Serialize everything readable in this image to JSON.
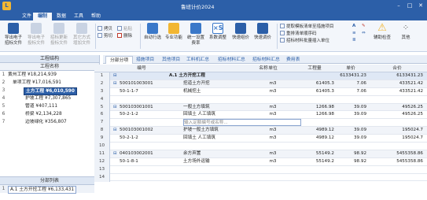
{
  "app": {
    "title": "鲁班计价2024",
    "logo": "L"
  },
  "menu": {
    "tabs": [
      "文件",
      "编制",
      "数据",
      "工具",
      "帮助"
    ],
    "active_index": 1
  },
  "ribbon": {
    "buttons": [
      {
        "label": "导出电子\n招标文件",
        "icon": "export-icon",
        "disabled": false
      },
      {
        "label": "导出电子\n投标文件",
        "icon": "export-bid-icon",
        "disabled": true
      },
      {
        "label": "招标更新\n投标文件",
        "icon": "update-icon",
        "disabled": true
      },
      {
        "label": "其它方式\n增加文件",
        "icon": "add-file-icon",
        "disabled": true
      }
    ],
    "small_group1": [
      "拷贝",
      "剪切",
      "粘贴",
      "删除"
    ],
    "buttons2": [
      {
        "label": "自动行选",
        "icon": "auto-select-icon"
      },
      {
        "label": "专业功能",
        "icon": "pro-function-icon"
      },
      {
        "label": "统一设置\n费率",
        "icon": "rate-icon"
      },
      {
        "label": "系数调整",
        "icon": "coefficient-icon"
      },
      {
        "label": "快速组价",
        "icon": "quick-price-icon"
      },
      {
        "label": "快速调价",
        "icon": "quick-adjust-icon"
      }
    ],
    "small_group2": [
      "提取模板清单至措施项目",
      "重排清单顺序码",
      "招标材料批量插入单位"
    ],
    "buttons3": [
      {
        "label": "辅助检查",
        "icon": "warning-icon"
      },
      {
        "label": "其他",
        "icon": "more-icon"
      }
    ]
  },
  "left": {
    "header": "工程结构",
    "col_header": "工程名称",
    "tree": [
      {
        "num": "1",
        "text": "黄州工程 ¥18,214,939",
        "indent": 0,
        "selected": false
      },
      {
        "num": "2",
        "text": "单项工程 ¥17,016,591",
        "indent": 1,
        "selected": false
      },
      {
        "num": "3",
        "text": "土方工程 ¥6,010,590",
        "indent": 2,
        "selected": true
      },
      {
        "num": "4",
        "text": "护坡工程 ¥7,307,865",
        "indent": 2,
        "selected": false
      },
      {
        "num": "5",
        "text": "管道 ¥407,111",
        "indent": 2,
        "selected": false
      },
      {
        "num": "6",
        "text": "桥梁 ¥2,134,228",
        "indent": 2,
        "selected": false
      },
      {
        "num": "7",
        "text": "边坡绿化 ¥356,807",
        "indent": 2,
        "selected": false
      }
    ],
    "bottom_header": "分部列表",
    "bottom_row": {
      "num": "1",
      "text": "A.1 土方开挖工程 ¥6,133,431"
    }
  },
  "tabs": [
    "分部分项",
    "措施项目",
    "其他项目",
    "工料机汇总",
    "招标材料汇总",
    "招标材料汇总",
    "费用表"
  ],
  "grid": {
    "headers": [
      "编号",
      "名称",
      "单位",
      "工程量",
      "单价",
      "合价"
    ],
    "rows": [
      {
        "n": "1",
        "type": "cat",
        "code": "",
        "name": "A.1 土方开挖工程",
        "unit": "",
        "qty": "",
        "price": "6133431.23",
        "total": "6133431.23"
      },
      {
        "n": "2",
        "type": "main",
        "code": "500101003001",
        "name": "挖道土方开挖",
        "unit": "m3",
        "qty": "61405.3",
        "price": "7.06",
        "total": "433521.42"
      },
      {
        "n": "3",
        "type": "sub",
        "code": "50-1-1-7",
        "name": "机械挖土",
        "unit": "m3",
        "qty": "61405.3",
        "price": "7.06",
        "total": "433521.42"
      },
      {
        "n": "4",
        "type": "empty",
        "code": "",
        "name": "",
        "unit": "",
        "qty": "",
        "price": "",
        "total": ""
      },
      {
        "n": "5",
        "type": "main",
        "code": "500103001001",
        "name": "一般土方填筑",
        "unit": "m3",
        "qty": "1266.98",
        "price": "39.09",
        "total": "49526.25"
      },
      {
        "n": "6",
        "type": "sub",
        "code": "50-2-1-2",
        "name": "回填土 人工填筑",
        "unit": "m3",
        "qty": "1266.98",
        "price": "39.09",
        "total": "49526.25"
      },
      {
        "n": "7",
        "type": "edit",
        "code": "",
        "name": "输入定额编号或名称...",
        "unit": "",
        "qty": "",
        "price": "",
        "total": ""
      },
      {
        "n": "8",
        "type": "main",
        "code": "500103001002",
        "name": "护坡一般土方填筑",
        "unit": "m3",
        "qty": "4989.12",
        "price": "39.09",
        "total": "195024.7"
      },
      {
        "n": "9",
        "type": "sub",
        "code": "50-2-1-2",
        "name": "回填土 人工填筑",
        "unit": "m3",
        "qty": "4989.12",
        "price": "39.09",
        "total": "195024.7"
      },
      {
        "n": "10",
        "type": "empty",
        "code": "",
        "name": "",
        "unit": "",
        "qty": "",
        "price": "",
        "total": ""
      },
      {
        "n": "11",
        "type": "main",
        "code": "040103002001",
        "name": "余方弃置",
        "unit": "m3",
        "qty": "55149.2",
        "price": "98.92",
        "total": "5455358.86"
      },
      {
        "n": "12",
        "type": "sub",
        "code": "50-1-8-1",
        "name": "土方场外运输",
        "unit": "m3",
        "qty": "55149.2",
        "price": "98.92",
        "total": "5455358.86"
      },
      {
        "n": "13",
        "type": "empty",
        "code": "",
        "name": "",
        "unit": "",
        "qty": "",
        "price": "",
        "total": ""
      },
      {
        "n": "14",
        "type": "empty",
        "code": "",
        "name": "",
        "unit": "",
        "qty": "",
        "price": "",
        "total": ""
      }
    ]
  },
  "colors": {
    "brand": "#2c5fa8",
    "accent": "#f2b632"
  }
}
